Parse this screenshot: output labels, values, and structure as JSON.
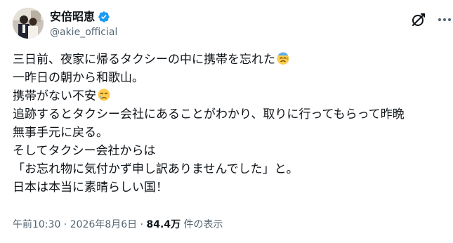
{
  "post": {
    "author": {
      "display_name": "安倍昭恵",
      "handle": "@akie_official",
      "verified": true
    },
    "lines": [
      "三日前、夜家に帰るタクシーの中に携帯を忘れた",
      "一昨日の朝から和歌山。",
      "携帯がない不安",
      "追跡するとタクシー会社にあることがわかり、取りに行ってもらって昨晩",
      "無事手元に戻る。",
      "そしてタクシー会社からは",
      "「お忘れ物に気付かず申し訳ありませんでした」と。",
      "日本は本当に素晴らしい国！"
    ],
    "emojis": {
      "line0": "sweat-emoji",
      "line2": "crying-emoji"
    },
    "meta": {
      "time": "午前10:30",
      "separator1": " · ",
      "date": "2026年8月6日",
      "separator2": " · ",
      "views_count": "84.4万",
      "views_label": " 件の表示"
    }
  },
  "colors": {
    "text": "#0f1419",
    "secondary": "#536471",
    "verified": "#1d9bf0"
  },
  "icons": [
    "verified-badge-icon",
    "grok-icon",
    "more-icon"
  ]
}
